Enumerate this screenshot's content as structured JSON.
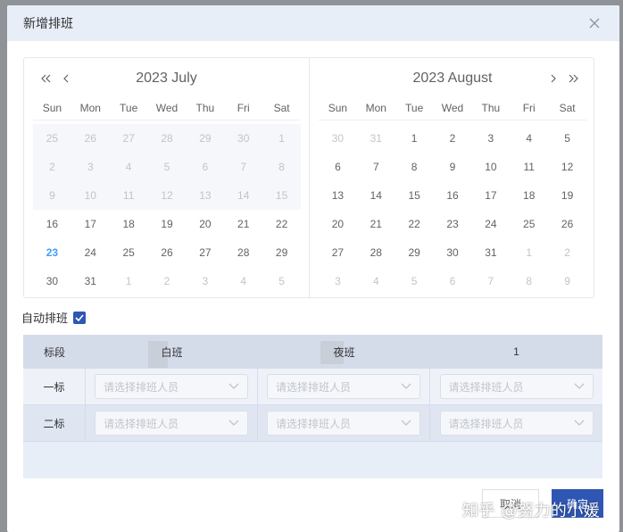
{
  "dialog": {
    "title": "新增排班"
  },
  "calendar": {
    "weekdays": [
      "Sun",
      "Mon",
      "Tue",
      "Wed",
      "Thu",
      "Fri",
      "Sat"
    ],
    "left": {
      "title": "2023  July",
      "rows": [
        [
          "25",
          "26",
          "27",
          "28",
          "29",
          "30",
          "1"
        ],
        [
          "2",
          "3",
          "4",
          "5",
          "6",
          "7",
          "8"
        ],
        [
          "9",
          "10",
          "11",
          "12",
          "13",
          "14",
          "15"
        ],
        [
          "16",
          "17",
          "18",
          "19",
          "20",
          "21",
          "22"
        ],
        [
          "23",
          "24",
          "25",
          "26",
          "27",
          "28",
          "29"
        ],
        [
          "30",
          "31",
          "1",
          "2",
          "3",
          "4",
          "5"
        ]
      ]
    },
    "right": {
      "title": "2023  August",
      "rows": [
        [
          "30",
          "31",
          "1",
          "2",
          "3",
          "4",
          "5"
        ],
        [
          "6",
          "7",
          "8",
          "9",
          "10",
          "11",
          "12"
        ],
        [
          "13",
          "14",
          "15",
          "16",
          "17",
          "18",
          "19"
        ],
        [
          "20",
          "21",
          "22",
          "23",
          "24",
          "25",
          "26"
        ],
        [
          "27",
          "28",
          "29",
          "30",
          "31",
          "1",
          "2"
        ],
        [
          "3",
          "4",
          "5",
          "6",
          "7",
          "8",
          "9"
        ]
      ]
    },
    "today": "23"
  },
  "auto_schedule": {
    "label": "自动排班",
    "checked": true
  },
  "grid": {
    "headers": [
      "标段",
      "白班",
      "夜班",
      "1"
    ],
    "rows": [
      {
        "label": "一标",
        "placeholders": [
          "请选择排班人员",
          "请选择排班人员",
          "请选择排班人员"
        ]
      },
      {
        "label": "二标",
        "placeholders": [
          "请选择排班人员",
          "请选择排班人员",
          "请选择排班人员"
        ]
      }
    ]
  },
  "footer": {
    "cancel_label": "取消",
    "ok_label": "确定"
  },
  "watermark": "知乎 @努力的小媛",
  "colors": {
    "accent": "#2f56b3",
    "today": "#409eff",
    "header_bg": "#e8eef7"
  }
}
